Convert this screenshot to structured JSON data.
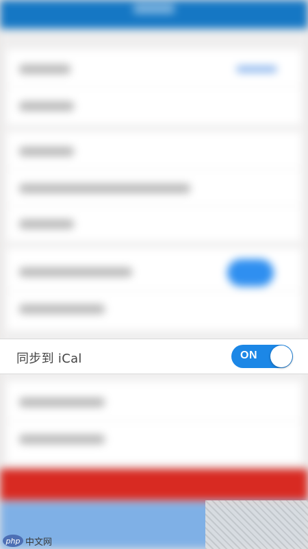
{
  "sync_row": {
    "label": "同步到 iCal",
    "toggle_label": "ON",
    "toggle_on": true
  },
  "watermark": {
    "logo_text": "php",
    "site_text": "中文网"
  },
  "colors": {
    "header_blue": "#1577c4",
    "toggle_blue": "#1c87e6",
    "danger_red": "#d82a22",
    "light_blue": "#7fb0e6"
  }
}
